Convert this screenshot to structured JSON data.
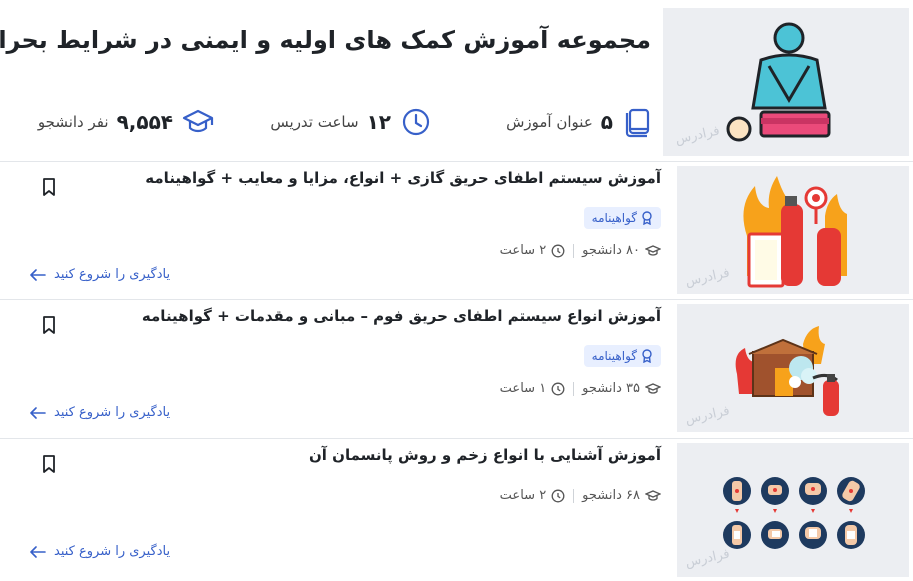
{
  "header": {
    "title": "مجموعه آموزش کمک های اولیه و ایمنی در شرایط بحرانی",
    "watermark": "فرادرس",
    "stats": [
      {
        "num": "۵",
        "text": "عنوان آموزش",
        "icon": "book-icon"
      },
      {
        "num": "۱۲",
        "text": "ساعت تدریس",
        "icon": "clock-icon"
      },
      {
        "num": "۹,۵۵۴",
        "text": "نفر دانشجو",
        "icon": "graduation-cap-icon"
      }
    ]
  },
  "courses": [
    {
      "title": "آموزش سیستم اطفای حریق گازی + انواع، مزایا و معایب + گواهینامه",
      "badge": "گواهینامه",
      "students": "۸۰ دانشجو",
      "hours": "۲ ساعت",
      "cta": "یادگیری را شروع کنید",
      "thumb_icon": "fire-extinguisher-icon"
    },
    {
      "title": "آموزش انواع سیستم اطفای حریق فوم – مبانی و مقدمات + گواهینامه",
      "badge": "گواهینامه",
      "students": "۳۵ دانشجو",
      "hours": "۱ ساعت",
      "cta": "یادگیری را شروع کنید",
      "thumb_icon": "burning-house-icon"
    },
    {
      "title": "آموزش آشنایی با انواع زخم و روش پانسمان آن",
      "students": "۶۸ دانشجو",
      "hours": "۲ ساعت",
      "cta": "یادگیری را شروع کنید",
      "thumb_icon": "wound-types-icon"
    }
  ],
  "colors": {
    "accent": "#3760c9",
    "badge_bg": "#e8efff",
    "thumb_bg": "#eceef2",
    "icon_bg": "#e8efff"
  }
}
